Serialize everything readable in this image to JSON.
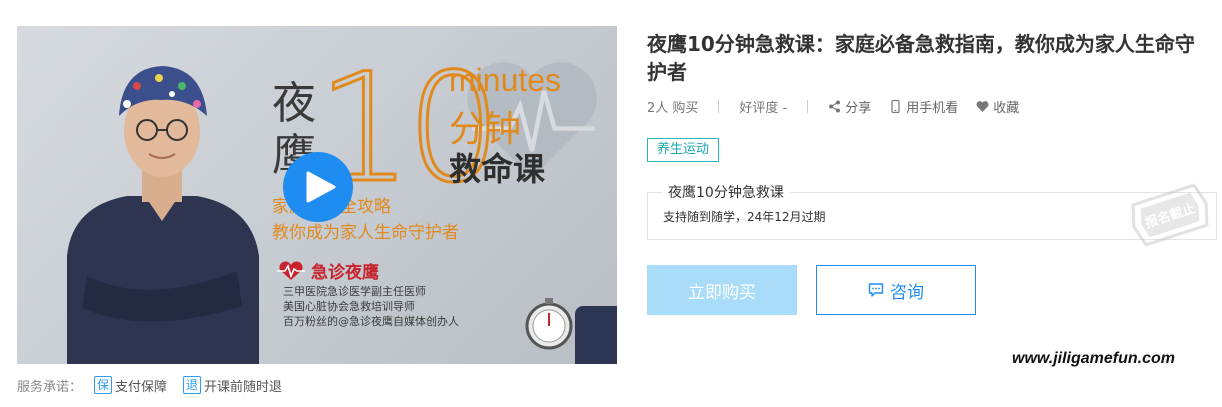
{
  "cover": {
    "title_vertical": "夜鹰",
    "big_number": "10",
    "minutes": "minutes",
    "fenzhong": "分钟",
    "course_word": "救命课",
    "subtitle_line1": "家庭急救全攻略",
    "subtitle_line2": "教你成为家人生命守护者",
    "brand_name": "急诊夜鹰",
    "credentials": [
      "三甲医院急诊医学副主任医师",
      "美国心脏协会急救培训导师",
      "百万粉丝的@急诊夜鹰自媒体创办人"
    ],
    "play_icon": "play-icon"
  },
  "course": {
    "title": "夜鹰10分钟急救课：家庭必备急救指南，教你成为家人生命守护者",
    "buyers": "2人 购买",
    "rating": "好评度 -",
    "share": "分享",
    "mobile": "用手机看",
    "favorite": "收藏",
    "tag": "养生运动"
  },
  "plan": {
    "name": "夜鹰10分钟急救课",
    "desc": "支持随到随学，24年12月过期",
    "stamp_text": "报名截止"
  },
  "actions": {
    "buy": "立即购买",
    "consult": "咨询"
  },
  "service": {
    "label": "服务承诺：",
    "items": [
      {
        "icon_char": "保",
        "label": "支付保障"
      },
      {
        "icon_char": "退",
        "label": "开课前随时退"
      }
    ]
  },
  "watermark": "www.jiligamefun.com",
  "colors": {
    "accent_blue": "#1e8cf0",
    "buy_button": "#a8dcf9",
    "tag_teal": "#1aa7b4",
    "cover_orange": "#e08a1e"
  }
}
